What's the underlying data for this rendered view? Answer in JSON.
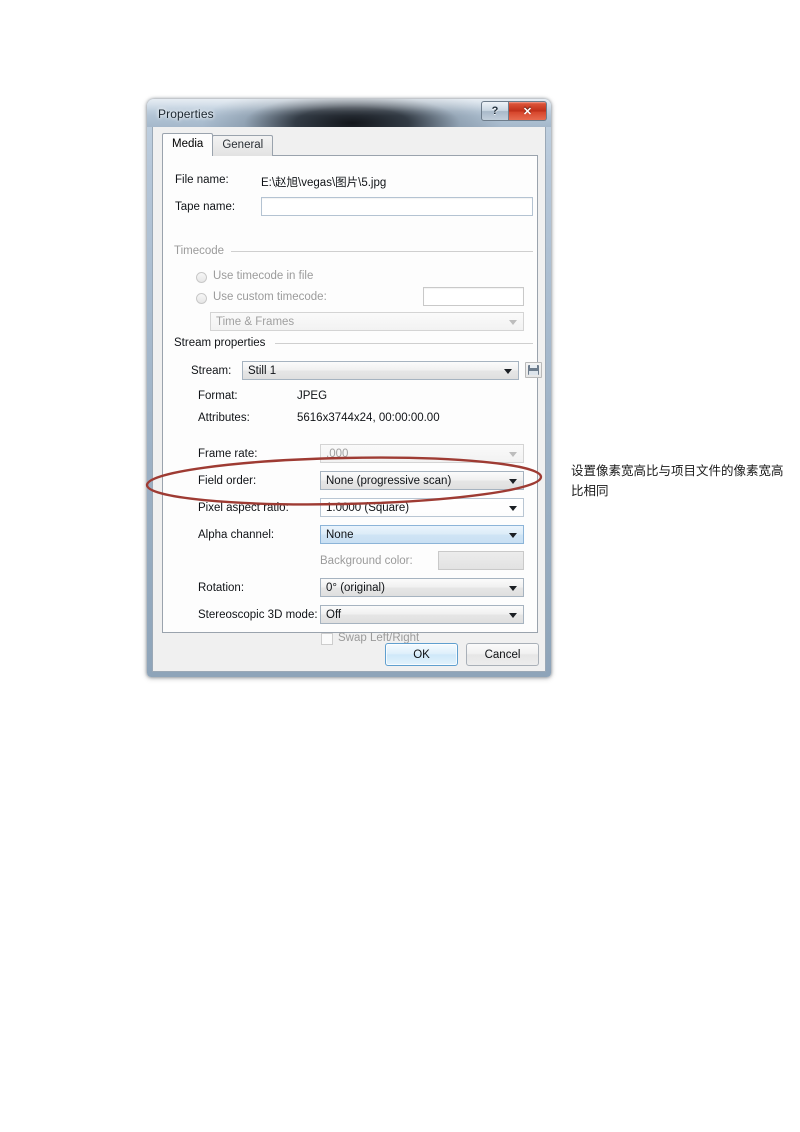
{
  "window": {
    "title": "Properties",
    "help_label": "?",
    "close_label": "✕"
  },
  "tabs": [
    {
      "label": "Media",
      "active": true
    },
    {
      "label": "General",
      "active": false
    }
  ],
  "media": {
    "file_name_label": "File name:",
    "file_name_value": "E:\\赵旭\\vegas\\图片\\5.jpg",
    "tape_name_label": "Tape name:",
    "tape_name_value": "",
    "tape_name_placeholder": "",
    "timecode": {
      "group_label": "Timecode",
      "use_timecode_in_file_label": "Use timecode in file",
      "use_custom_timecode_label": "Use custom timecode:",
      "custom_timecode_value": "",
      "format_value": "Time & Frames"
    },
    "stream_properties": {
      "group_label": "Stream properties",
      "stream_label": "Stream:",
      "stream_value": "Still 1",
      "save_icon": "floppy-disk-icon",
      "format_label": "Format:",
      "format_value": "JPEG",
      "attributes_label": "Attributes:",
      "attributes_value": "5616x3744x24, 00:00:00.00",
      "frame_rate_label": "Frame rate:",
      "frame_rate_value": ".000",
      "field_order_label": "Field order:",
      "field_order_value": "None (progressive scan)",
      "pixel_aspect_ratio_label": "Pixel aspect ratio:",
      "pixel_aspect_ratio_value": "1.0000 (Square)",
      "alpha_channel_label": "Alpha channel:",
      "alpha_channel_value": "None",
      "background_color_label": "Background color:",
      "rotation_label": "Rotation:",
      "rotation_value": "0° (original)",
      "stereoscopic_label": "Stereoscopic 3D mode:",
      "stereoscopic_value": "Off",
      "swap_left_right_label": "Swap Left/Right"
    }
  },
  "footer": {
    "ok_label": "OK",
    "cancel_label": "Cancel"
  },
  "annotation": {
    "text": "设置像素宽高比与项目文件的像素宽高比相同",
    "ellipse_color": "#9e3b33"
  }
}
